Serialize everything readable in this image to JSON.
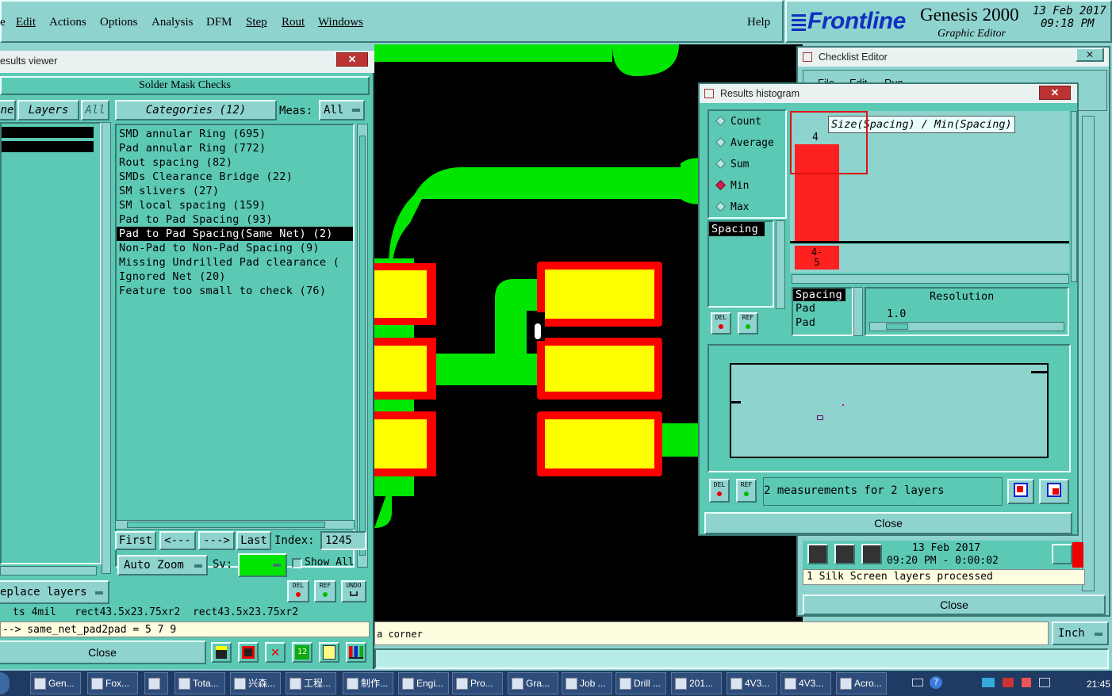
{
  "menubar": {
    "items": [
      "e",
      "Edit",
      "Actions",
      "Options",
      "Analysis",
      "DFM",
      "Step",
      "Rout",
      "Windows"
    ],
    "help": "Help"
  },
  "brand": {
    "logo": "Frontline",
    "product": "Genesis 2000",
    "subtitle": "Graphic Editor",
    "date": "13 Feb 2017",
    "time": "09:18 PM"
  },
  "results_viewer": {
    "title": "esults viewer",
    "header": "Solder Mask Checks",
    "tab_left": "ne",
    "tab_layers": "Layers",
    "tab_all": "All",
    "categories_label": "Categories (12)",
    "meas_label": "Meas:",
    "meas_value": "All",
    "categories": [
      "SMD annular Ring (695)",
      "Pad annular Ring (772)",
      "Rout spacing (82)",
      "SMDs Clearance Bridge (22)",
      "SM slivers (27)",
      "SM local spacing (159)",
      "Pad to Pad Spacing (93)",
      "Pad to Pad Spacing(Same Net) (2)",
      "Non-Pad to Non-Pad Spacing (9)",
      "Missing Undrilled Pad clearance (",
      "Ignored Net (20)",
      "Feature too small to check (76)"
    ],
    "selected_index": 7,
    "nav": {
      "first": "First",
      "prev": "<---",
      "next": "--->",
      "last": "Last",
      "index_label": "Index:",
      "index_value": "1245"
    },
    "auto_zoom": "Auto Zoom",
    "sv_label": "Sv:",
    "show_all": "Show All",
    "replace_layers": "eplace layers",
    "del": "DEL",
    "ref": "REF",
    "undo": "UNDO",
    "info_line": "ts 4mil   rect43.5x23.75xr2  rect43.5x23.75xr2",
    "param_line": "--> same_net_pad2pad = 5 7 9",
    "close": "Close"
  },
  "status_bar": {
    "message": "a corner",
    "units": "Inch"
  },
  "checklist_editor": {
    "title": "Checklist Editor",
    "menu": [
      "File",
      "Edit",
      "Run"
    ],
    "date": "13 Feb 2017",
    "run_time": "09:20 PM - 0:00:02",
    "status": "1 Silk Screen layers processed",
    "close": "Close"
  },
  "histogram": {
    "title": "Results histogram",
    "modes": [
      "Count",
      "Average",
      "Sum",
      "Min",
      "Max"
    ],
    "selected_mode": "Min",
    "chart_title": "Size(Spacing) / Min(Spacing)",
    "bar_value": "4",
    "bin_label_top": "4-",
    "bin_label_bottom": "5",
    "measure_list": [
      "Spacing"
    ],
    "attr_list": [
      "Spacing",
      "Pad",
      "Pad"
    ],
    "resolution_label": "Resolution",
    "resolution_value": "1.0",
    "measurements_text": "2 measurements for 2 layers",
    "del": "DEL",
    "ref": "REF",
    "close": "Close"
  },
  "taskbar": {
    "items": [
      "Gen...",
      "Fox...",
      "",
      "Tota...",
      "兴森...",
      "工程...",
      "制作...",
      "Engi...",
      "Pro...",
      "Gra...",
      "Job ...",
      "Drill ...",
      "201...",
      "4V3...",
      "4V3...",
      "Acro..."
    ],
    "clock": "21:45"
  },
  "colors": {
    "panel_bg": "#5cc9b4",
    "window_bg": "#8fd3cf",
    "trace_green": "#00e600",
    "pad_yellow": "#ffff00",
    "mask_red": "#ff0000",
    "canvas_black": "#000000"
  }
}
